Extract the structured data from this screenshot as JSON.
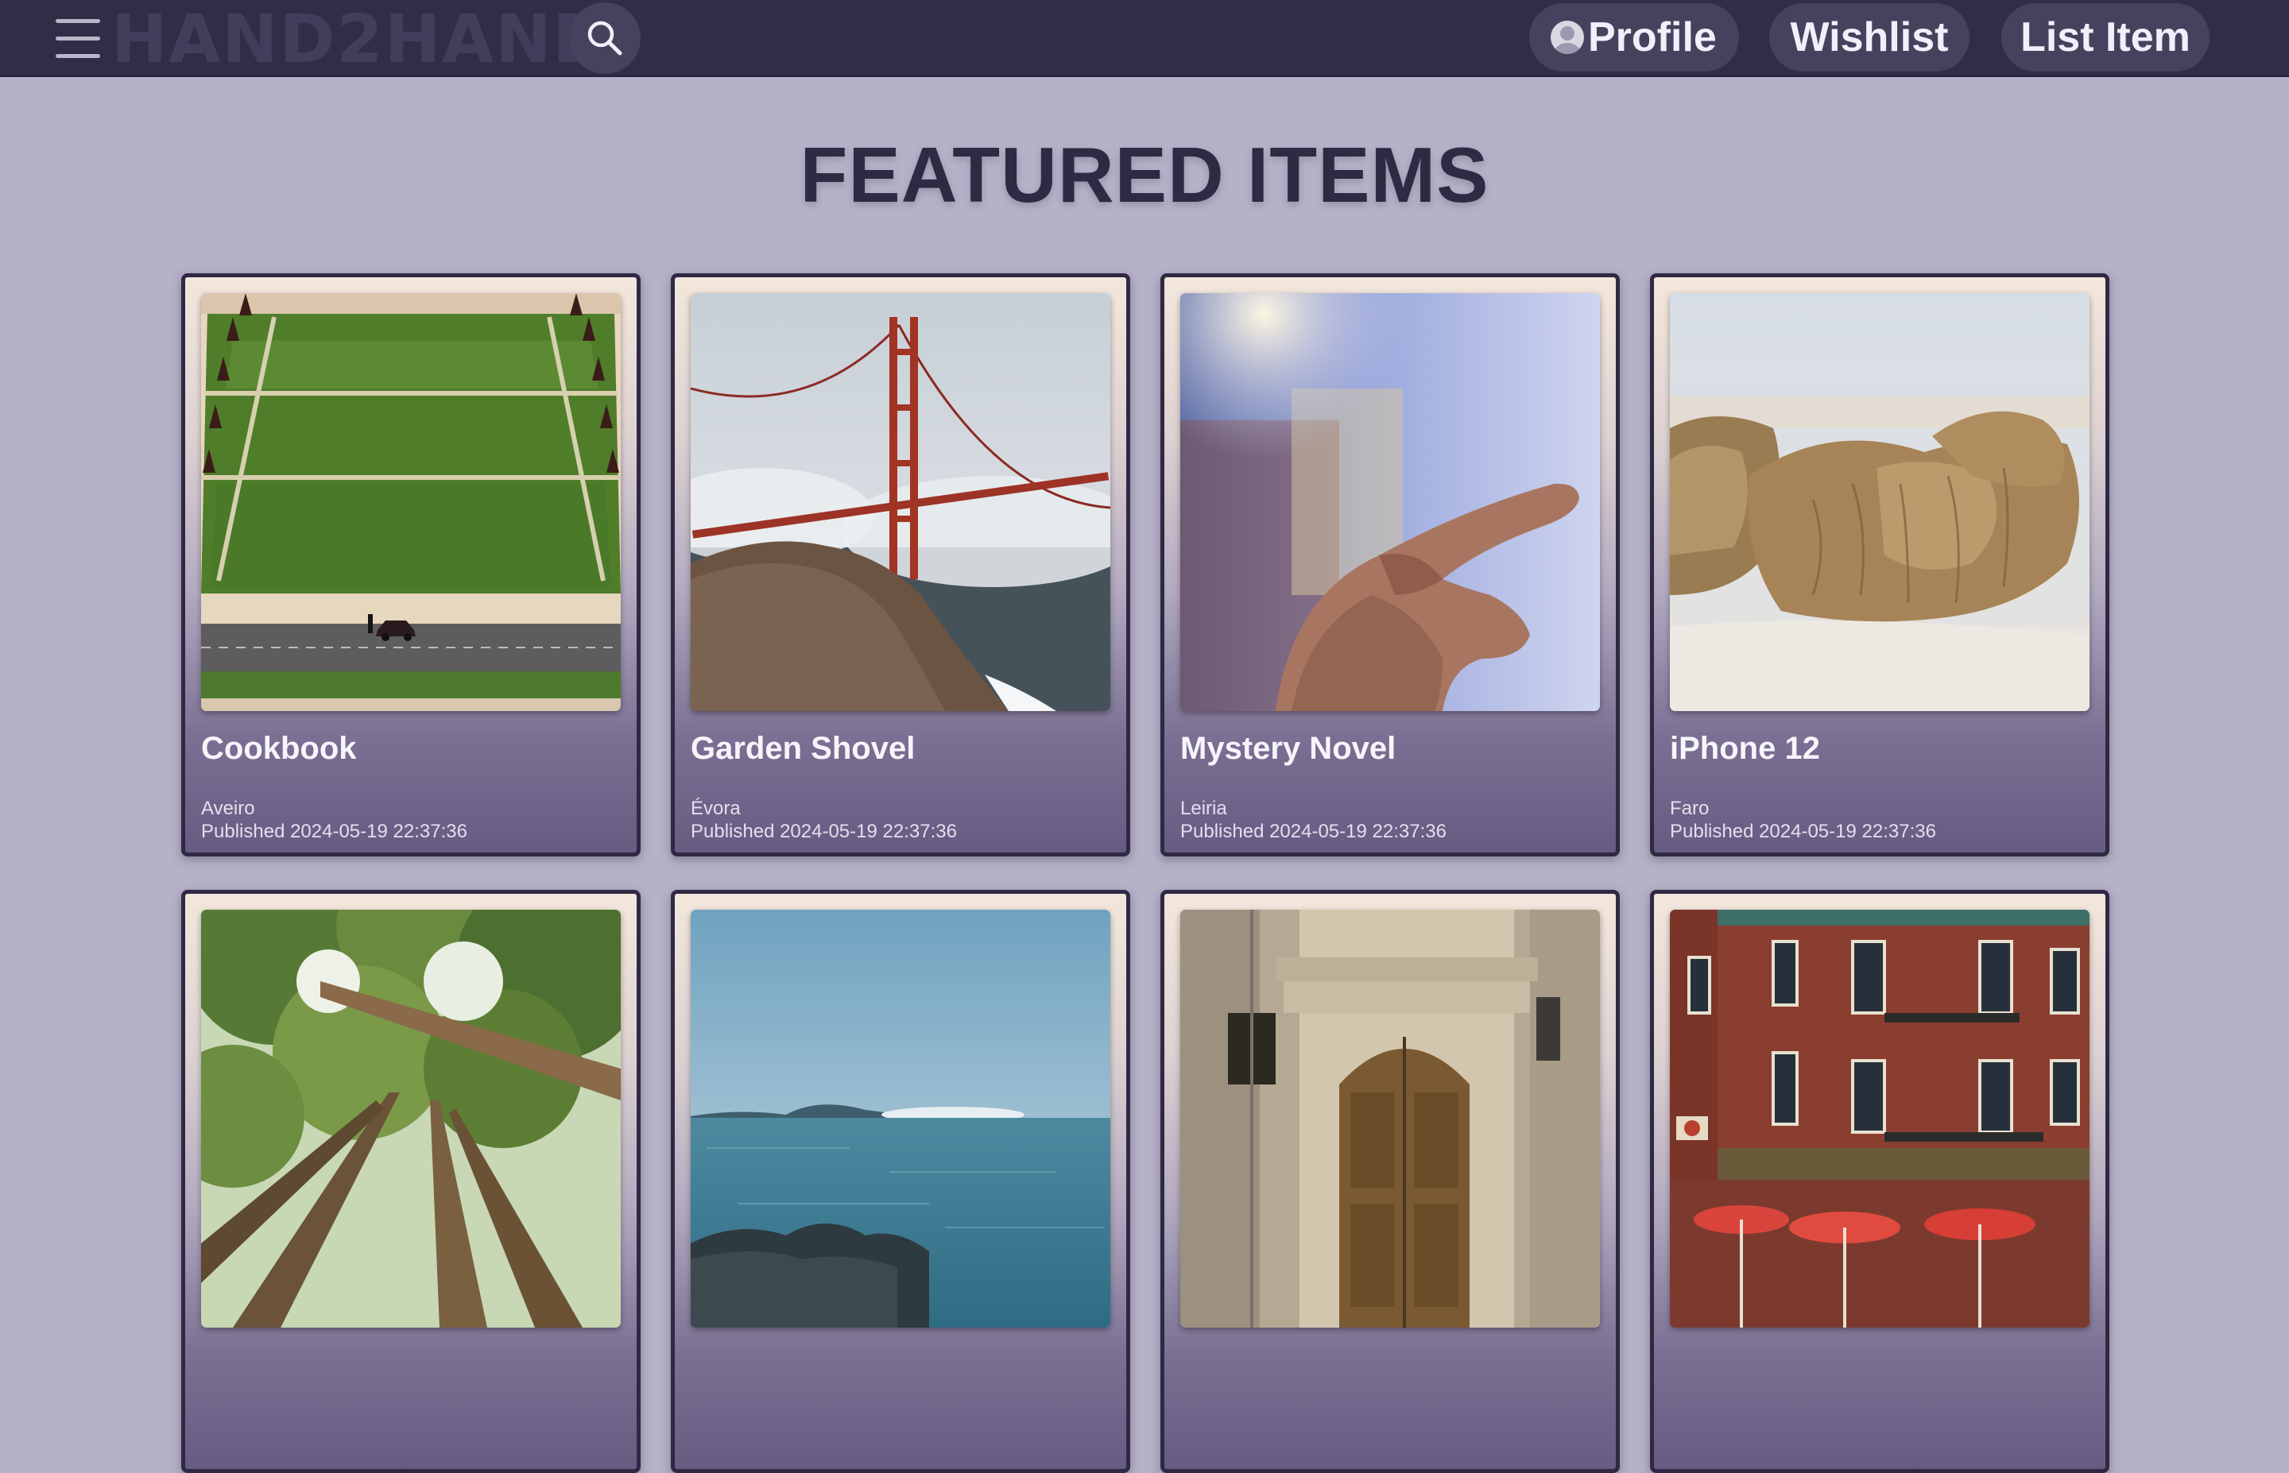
{
  "header": {
    "logo": "HAND2HAND",
    "nav": {
      "profile": "Profile",
      "wishlist": "Wishlist",
      "list_item": "List Item"
    }
  },
  "main": {
    "title": "FEATURED ITEMS",
    "items": [
      {
        "title": "Cookbook",
        "location": "Aveiro",
        "published": "Published 2024-05-19 22:37:36",
        "image": "park-lawn-photo"
      },
      {
        "title": "Garden Shovel",
        "location": "Évora",
        "published": "Published 2024-05-19 22:37:36",
        "image": "golden-gate-bridge-photo"
      },
      {
        "title": "Mystery Novel",
        "location": "Leiria",
        "published": "Published 2024-05-19 22:37:36",
        "image": "pointing-hand-photo"
      },
      {
        "title": "iPhone 12",
        "location": "Faro",
        "published": "Published 2024-05-19 22:37:36",
        "image": "walrus-photo"
      },
      {
        "title": "",
        "location": "",
        "published": "",
        "image": "redwood-forest-photo"
      },
      {
        "title": "",
        "location": "",
        "published": "",
        "image": "sea-coast-photo"
      },
      {
        "title": "",
        "location": "",
        "published": "",
        "image": "old-door-photo"
      },
      {
        "title": "",
        "location": "",
        "published": "",
        "image": "brick-building-photo"
      }
    ]
  },
  "colors": {
    "topbar": "#322d46",
    "background": "#b5b1c8",
    "pill": "#47415e",
    "title": "#2f2944"
  }
}
